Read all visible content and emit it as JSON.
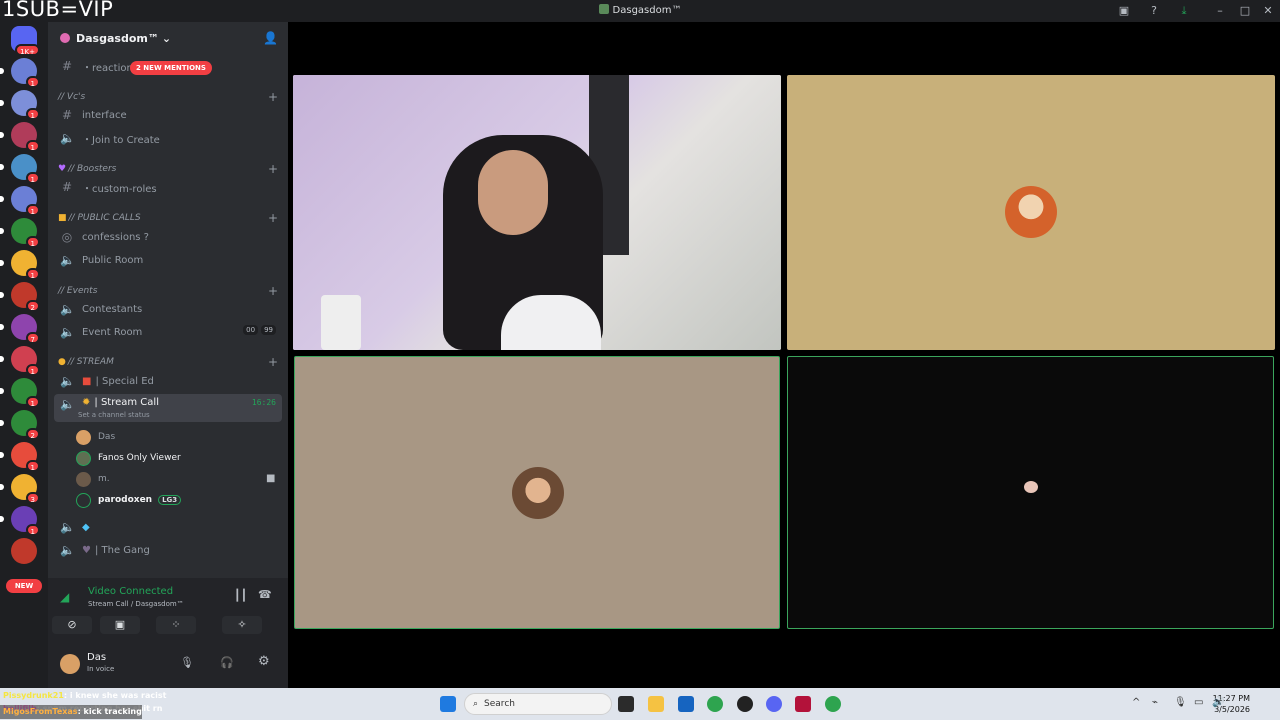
{
  "overlay_text": "1SUB=VIP",
  "window": {
    "title": "Dasgasdom™"
  },
  "rail": {
    "badges": [
      "1K+",
      "1",
      "1",
      "1",
      "1",
      "1",
      "1",
      "1",
      "2",
      "7",
      "1",
      "1",
      "2",
      "1",
      "3",
      "1"
    ],
    "new_label": "NEW"
  },
  "server": {
    "name": "Dasgasdom™",
    "new_mentions": "2 NEW MENTIONS"
  },
  "channels": {
    "reactions": "・reactions",
    "cat_vcs": "// Vc's",
    "interface": "interface",
    "join_to_create": "・Join to Create",
    "cat_boosters": "// Boosters",
    "custom_roles": "・custom-roles",
    "cat_public": "// PUBLIC CALLS",
    "confessions": "confessions ?",
    "public_room": "Public Room",
    "cat_events": "// Events",
    "contestants": "Contestants",
    "event_room": "Event Room",
    "event_counts": [
      "00",
      "99"
    ],
    "cat_stream": "// STREAM",
    "special_ed": "| Special Ed",
    "stream_call": "| Stream Call",
    "stream_timer": "16:26",
    "channel_status": "Set a channel status",
    "the_gang": "| The Gang"
  },
  "voice_users": [
    {
      "name": "Das",
      "color": "#d9a066"
    },
    {
      "name": "Fanos Only Viewer",
      "color": "#5f6f52"
    },
    {
      "name": "m.",
      "color": "#6b5a4a"
    },
    {
      "name": "parodoxen",
      "color": "#2b2d31",
      "tag": "LG3"
    }
  ],
  "voice_panel": {
    "status": "Video Connected",
    "location": "Stream Call / Dasgasdom™"
  },
  "user_panel": {
    "name": "Das",
    "status": "In voice"
  },
  "chat_overlay": [
    {
      "user": "Pissydrunk21",
      "text": ": i knew she was racist",
      "color": "#f5e642"
    },
    {
      "user": "bellifilb",
      "text": ": spam reporting her shit rn",
      "color": "#ff7ad9"
    },
    {
      "user": "MigosFromTexas",
      "text": ": kick tracking",
      "color": "#ffb040"
    }
  ],
  "taskbar": {
    "search_placeholder": "Search",
    "time": "11:27 PM",
    "date": "3/5/2026"
  }
}
